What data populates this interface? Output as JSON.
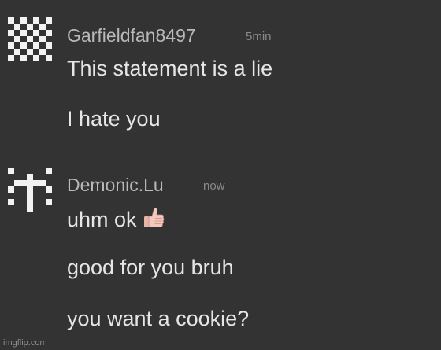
{
  "messages": [
    {
      "avatar_icon": "checkered-pixel-avatar-icon",
      "username": "Garfieldfan8497",
      "timestamp": "5min",
      "lines": [
        "This statement is a lie",
        "I hate you"
      ]
    },
    {
      "avatar_icon": "cross-pixel-avatar-icon",
      "username": "Demonic.Lu",
      "timestamp": "now",
      "lines": [
        "uhm ok",
        "good for you bruh",
        "you want a cookie?"
      ],
      "emoji_icon": "thumbs-up-icon"
    }
  ],
  "watermark": "imgflip.com",
  "colors": {
    "background": "#333333",
    "username": "#b9b9b9",
    "timestamp": "#8a8a8a",
    "message_text": "#e6e6e6",
    "avatar_pixel": "#f2f2f2"
  }
}
